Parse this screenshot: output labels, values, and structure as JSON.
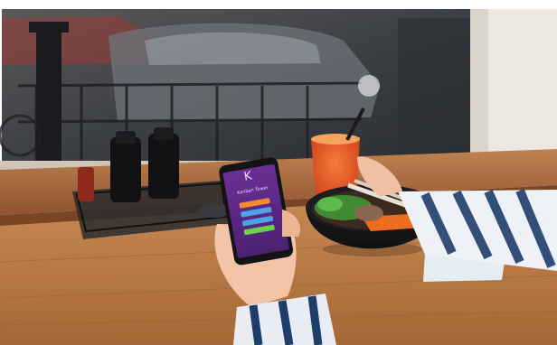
{
  "photo": {
    "subject": "",
    "colors": {
      "window_frame": "#e7e2da",
      "counter_wood": "#b8733f",
      "counter_dark": "#8b4f27",
      "phone_screen": "#5b2a86",
      "juice": "#e8532a",
      "bowl": "#1c1c1e",
      "sleeve_stripe": "#1f3d6b"
    }
  },
  "phone_app": {
    "logo_glyph": "K",
    "app_title": "Kanban Tower",
    "subtitle": "",
    "buttons": [
      {
        "color": "#f28b30"
      },
      {
        "color": "#4ea3e8"
      },
      {
        "color": "#4ea3e8"
      },
      {
        "color": "#6bd34a"
      }
    ]
  }
}
